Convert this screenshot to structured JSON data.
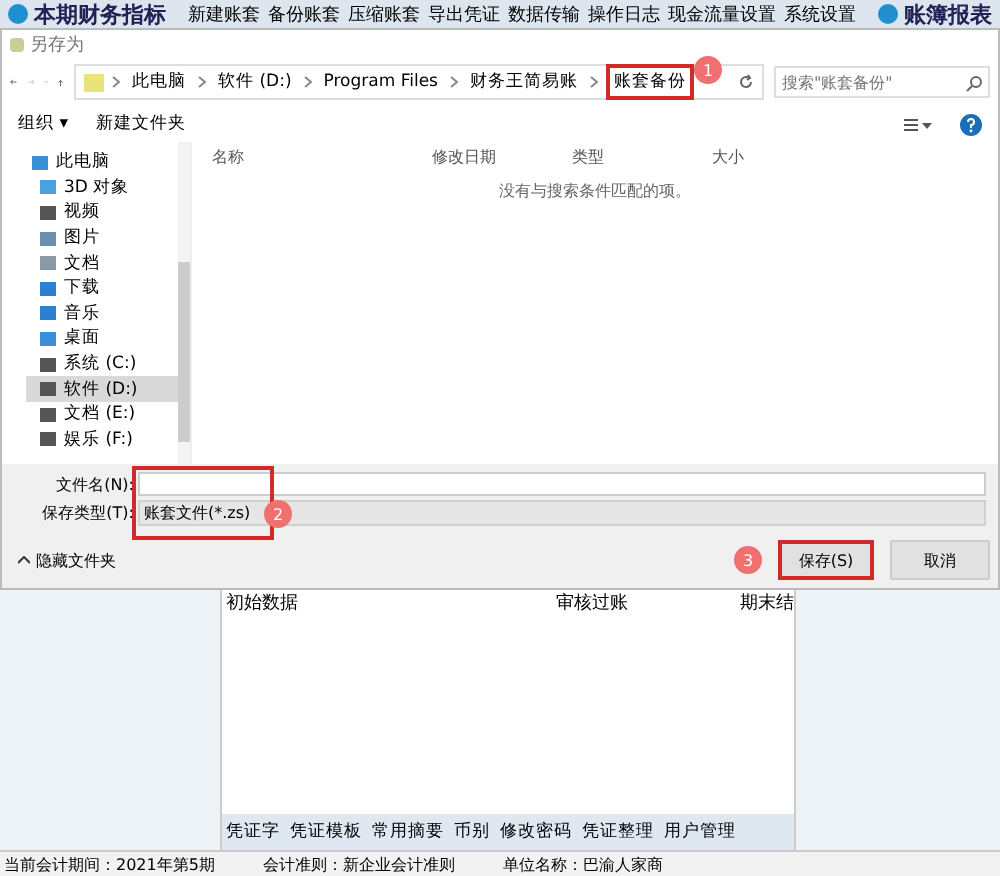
{
  "app_toolbar": {
    "left_button": "本期财务指标",
    "items": [
      "新建账套",
      "备份账套",
      "压缩账套",
      "导出凭证",
      "数据传输",
      "操作日志",
      "现金流量设置",
      "系统设置"
    ],
    "right_button": "账簿报表"
  },
  "dialog": {
    "title": "另存为",
    "breadcrumbs": [
      {
        "label": "此电脑",
        "highlighted": false
      },
      {
        "label": "软件 (D:)",
        "highlighted": false
      },
      {
        "label": "Program Files",
        "highlighted": false
      },
      {
        "label": "财务王简易账",
        "highlighted": false
      },
      {
        "label": "账套备份",
        "highlighted": true,
        "step": "1"
      }
    ],
    "search": {
      "placeholder": "搜索\"账套备份\""
    },
    "toolbar": [
      "组织 ▾",
      "新建文件夹"
    ],
    "sidebar": [
      {
        "label": "此电脑",
        "kind": "pc",
        "children": [
          {
            "label": "3D 对象",
            "kind": "cube",
            "selected": false
          },
          {
            "label": "视频",
            "kind": "video",
            "selected": false
          },
          {
            "label": "图片",
            "kind": "picture",
            "selected": false
          },
          {
            "label": "文档",
            "kind": "doc",
            "selected": false
          },
          {
            "label": "下载",
            "kind": "download",
            "selected": false
          },
          {
            "label": "音乐",
            "kind": "music",
            "selected": false
          },
          {
            "label": "桌面",
            "kind": "desktop",
            "selected": false
          },
          {
            "label": "系统 (C:)",
            "kind": "drive",
            "selected": false
          },
          {
            "label": "软件 (D:)",
            "kind": "drive",
            "selected": true
          },
          {
            "label": "文档 (E:)",
            "kind": "drive",
            "selected": false
          },
          {
            "label": "娱乐 (F:)",
            "kind": "drive",
            "selected": false
          }
        ]
      }
    ],
    "columns": [
      "名称",
      "修改日期",
      "类型",
      "大小"
    ],
    "empty_message": "没有与搜索条件匹配的项。",
    "file_name": {
      "label": "文件名(N):"
    },
    "save_type": {
      "label": "保存类型(T):",
      "value": "账套文件(*.zs)",
      "step": "2"
    },
    "hide_folders": "隐藏文件夹",
    "buttons": [
      {
        "label": "保存(S)",
        "highlighted": true,
        "step": "3"
      },
      {
        "label": "取消",
        "highlighted": false
      }
    ]
  },
  "background": {
    "headers": [
      "初始数据",
      "审核过账",
      "期末结"
    ],
    "tabs": [
      "凭证字",
      "凭证模板",
      "常用摘要",
      "币别",
      "修改密码",
      "凭证整理",
      "用户管理"
    ],
    "status_bar": [
      "当前会计期间：2021年第5期",
      "会计准则：新企业会计准则",
      "单位名称：巴渝人家商"
    ]
  }
}
